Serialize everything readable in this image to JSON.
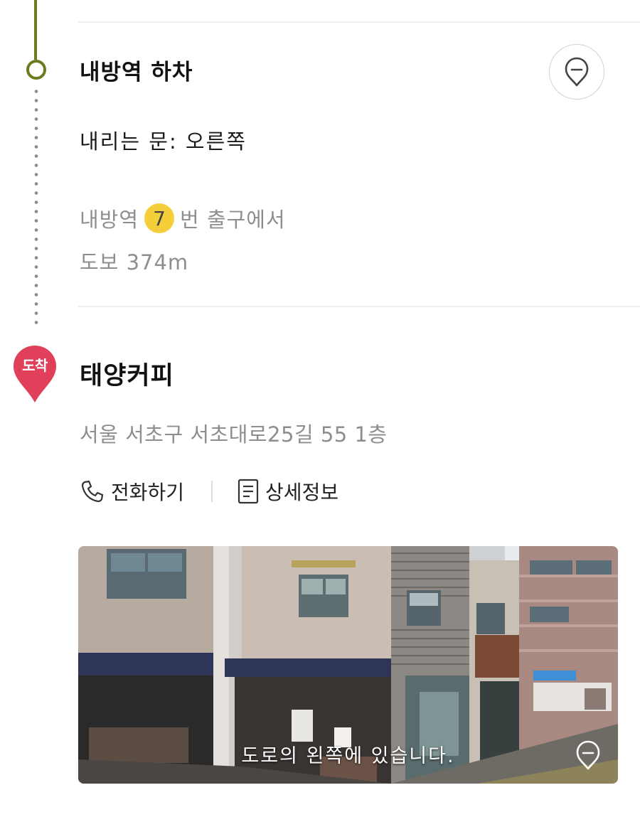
{
  "colors": {
    "timeline": "#6d7a1e",
    "arrival_pin": "#e0405a",
    "exit_badge": "#f5cf3a",
    "secondary_text": "#8e8e8e"
  },
  "stop": {
    "title": "내방역 하차",
    "exit_door": "내리는 문: 오른쪽",
    "walk_prefix": "내방역",
    "exit_number": "7",
    "walk_suffix": "번 출구에서",
    "walk_distance": "도보 374m",
    "map_icon": "map-pin-icon"
  },
  "destination": {
    "arrival_label": "도착",
    "title": "태양커피",
    "address": "서울 서초구 서초대로25길 55 1층",
    "call_label": "전화하기",
    "call_icon": "phone-icon",
    "detail_label": "상세정보",
    "detail_icon": "document-icon"
  },
  "photo": {
    "caption": "도로의 왼쪽에 있습니다.",
    "pin_icon": "map-pin-icon"
  }
}
